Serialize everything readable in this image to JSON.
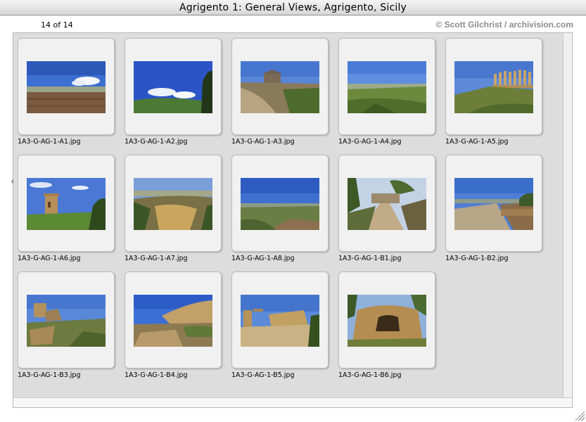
{
  "window": {
    "title": "Agrigento 1: General Views, Agrigento, Sicily"
  },
  "header": {
    "counter": "14 of 14",
    "copyright": "© Scott Gilchrist / archivision.com"
  },
  "thumbnails": [
    {
      "filename": "1A3-G-AG-1-A1.jpg",
      "scene": "plowed-field"
    },
    {
      "filename": "1A3-G-AG-1-A2.jpg",
      "scene": "hillside-clouds"
    },
    {
      "filename": "1A3-G-AG-1-A3.jpg",
      "scene": "temple-ridge"
    },
    {
      "filename": "1A3-G-AG-1-A4.jpg",
      "scene": "valley-panorama"
    },
    {
      "filename": "1A3-G-AG-1-A5.jpg",
      "scene": "temple-columns"
    },
    {
      "filename": "1A3-G-AG-1-A6.jpg",
      "scene": "stone-tomb"
    },
    {
      "filename": "1A3-G-AG-1-A7.jpg",
      "scene": "ruins-valley"
    },
    {
      "filename": "1A3-G-AG-1-A8.jpg",
      "scene": "plain-view"
    },
    {
      "filename": "1A3-G-AG-1-B1.jpg",
      "scene": "path-trees"
    },
    {
      "filename": "1A3-G-AG-1-B2.jpg",
      "scene": "road-wall"
    },
    {
      "filename": "1A3-G-AG-1-B3.jpg",
      "scene": "rock-blocks"
    },
    {
      "filename": "1A3-G-AG-1-B4.jpg",
      "scene": "rocky-slope"
    },
    {
      "filename": "1A3-G-AG-1-B5.jpg",
      "scene": "temple-ruins"
    },
    {
      "filename": "1A3-G-AG-1-B6.jpg",
      "scene": "rock-cave"
    }
  ]
}
